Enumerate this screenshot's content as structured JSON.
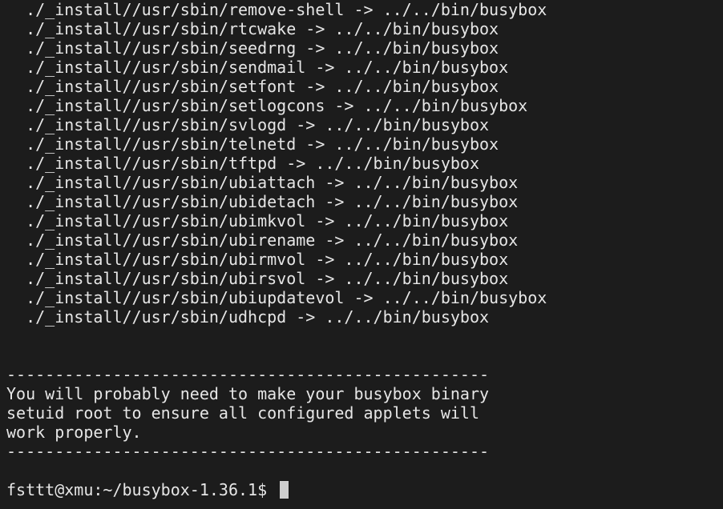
{
  "terminal": {
    "install_lines": [
      "  ./_install//usr/sbin/remove-shell -> ../../bin/busybox",
      "  ./_install//usr/sbin/rtcwake -> ../../bin/busybox",
      "  ./_install//usr/sbin/seedrng -> ../../bin/busybox",
      "  ./_install//usr/sbin/sendmail -> ../../bin/busybox",
      "  ./_install//usr/sbin/setfont -> ../../bin/busybox",
      "  ./_install//usr/sbin/setlogcons -> ../../bin/busybox",
      "  ./_install//usr/sbin/svlogd -> ../../bin/busybox",
      "  ./_install//usr/sbin/telnetd -> ../../bin/busybox",
      "  ./_install//usr/sbin/tftpd -> ../../bin/busybox",
      "  ./_install//usr/sbin/ubiattach -> ../../bin/busybox",
      "  ./_install//usr/sbin/ubidetach -> ../../bin/busybox",
      "  ./_install//usr/sbin/ubimkvol -> ../../bin/busybox",
      "  ./_install//usr/sbin/ubirename -> ../../bin/busybox",
      "  ./_install//usr/sbin/ubirmvol -> ../../bin/busybox",
      "  ./_install//usr/sbin/ubirsvol -> ../../bin/busybox",
      "  ./_install//usr/sbin/ubiupdatevol -> ../../bin/busybox",
      "  ./_install//usr/sbin/udhcpd -> ../../bin/busybox"
    ],
    "separator": "--------------------------------------------------",
    "message_lines": [
      "You will probably need to make your busybox binary",
      "setuid root to ensure all configured applets will",
      "work properly."
    ],
    "prompt": "fsttt@xmu:~/busybox-1.36.1$ ",
    "colors": {
      "background": "#1c1c1c",
      "text": "#e6e6e6",
      "cursor": "#cfcfcf"
    }
  }
}
